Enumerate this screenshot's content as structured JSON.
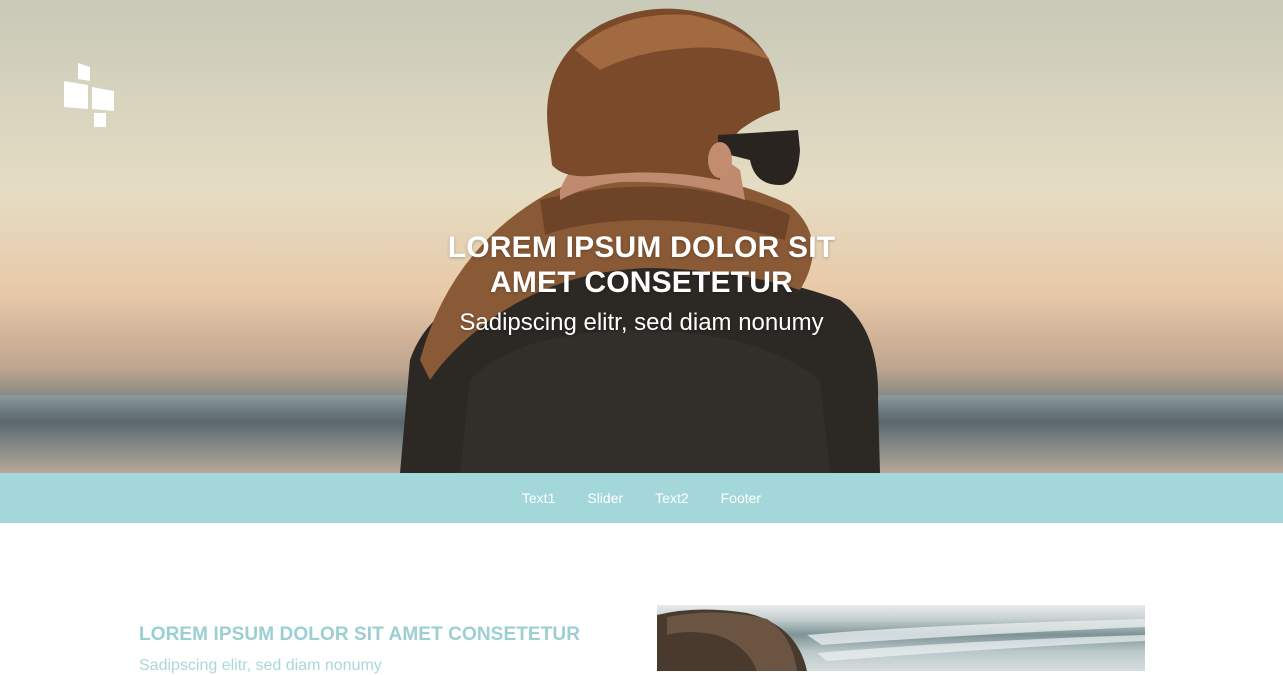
{
  "hero": {
    "title": "LOREM IPSUM DOLOR SIT AMET CONSETETUR",
    "subtitle": "Sadipscing elitr, sed diam nonumy"
  },
  "nav": {
    "items": [
      {
        "label": "Text1"
      },
      {
        "label": "Slider"
      },
      {
        "label": "Text2"
      },
      {
        "label": "Footer"
      }
    ]
  },
  "content": {
    "title": "LOREM IPSUM DOLOR SIT AMET CONSETETUR",
    "subtitle": "Sadipscing elitr, sed diam nonumy"
  },
  "colors": {
    "nav_background": "#a4d7d9",
    "accent_text": "#9bcfd1"
  },
  "icons": {
    "logo": "tile-blocks-logo"
  }
}
